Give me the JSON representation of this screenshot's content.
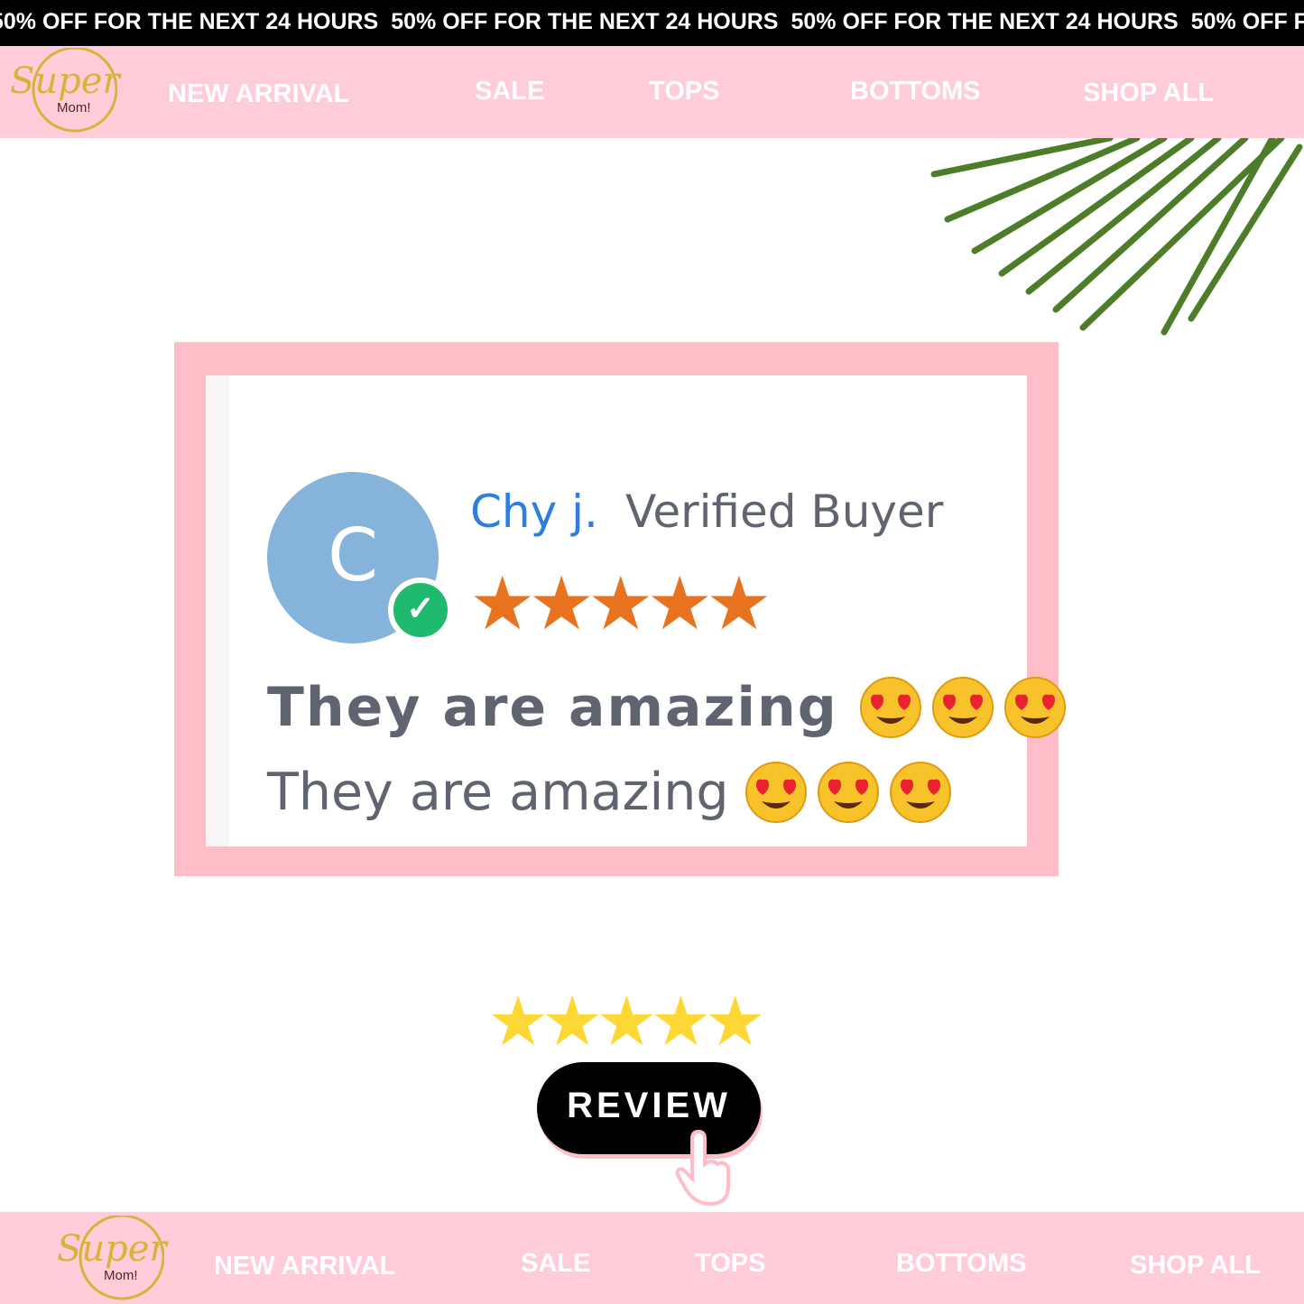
{
  "ticker": {
    "text": "50% OFF FOR THE NEXT 24 HOURS",
    "repeat": 4
  },
  "logo": {
    "text": "Super",
    "sub": "Mom!"
  },
  "nav": {
    "items": [
      "NEW ARRIVAL",
      "SALE",
      "TOPS",
      "BOTTOMS",
      "SHOP ALL"
    ]
  },
  "review": {
    "avatar_letter": "C",
    "name": "Chy j.",
    "badge": "Verified Buyer",
    "rating": 5,
    "rating_max": 5,
    "lines": [
      "They are amazing",
      "They are amazing"
    ],
    "emoji": "heart-eyes-face",
    "emoji_count": 3
  },
  "cta": {
    "rating": 5,
    "label": "REVIEW"
  },
  "colors": {
    "nav_bg": "#ffcdd9",
    "frame": "#ffbdc8",
    "avatar": "#85b3dc",
    "verified_green": "#1fba6e",
    "name_blue": "#2f7de1",
    "star_orange": "#e8731e",
    "star_yellow": "#fdd835"
  }
}
